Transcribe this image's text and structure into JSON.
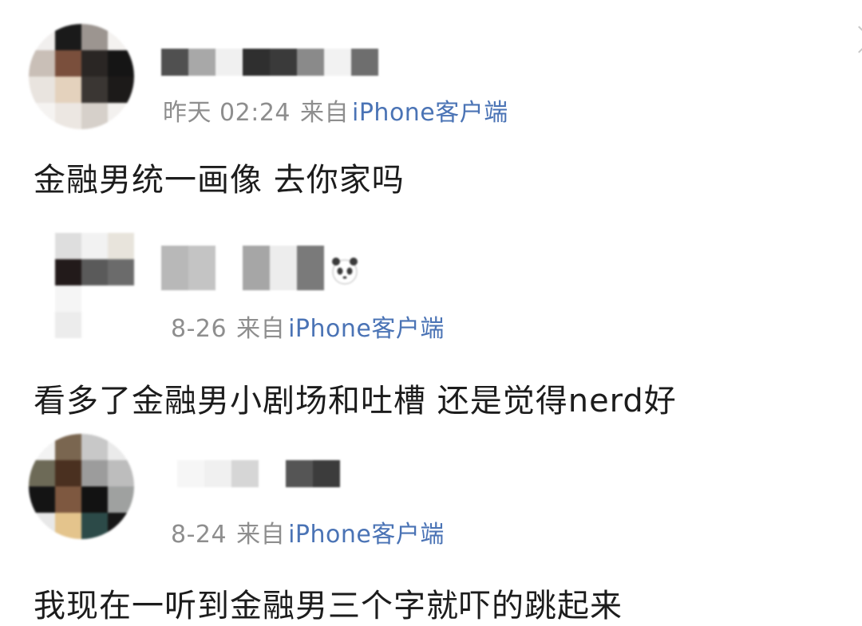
{
  "comments": [
    {
      "time": "昨天 02:24",
      "source_label": "来自",
      "client": "iPhone客户端",
      "text": "金融男统一画像 去你家吗"
    },
    {
      "time": "8-26",
      "source_label": "来自",
      "client": "iPhone客户端",
      "text": "看多了金融男小剧场和吐槽 还是觉得nerd好",
      "name_emoji": "panda-icon"
    },
    {
      "time": "8-24",
      "source_label": "来自",
      "client": "iPhone客户端",
      "text": "我现在一听到金融男三个字就吓的跳起来"
    }
  ],
  "colors": {
    "meta_gray": "#8e8e8e",
    "client_blue": "#4a73b5",
    "text_dark": "#1c1c1c"
  }
}
